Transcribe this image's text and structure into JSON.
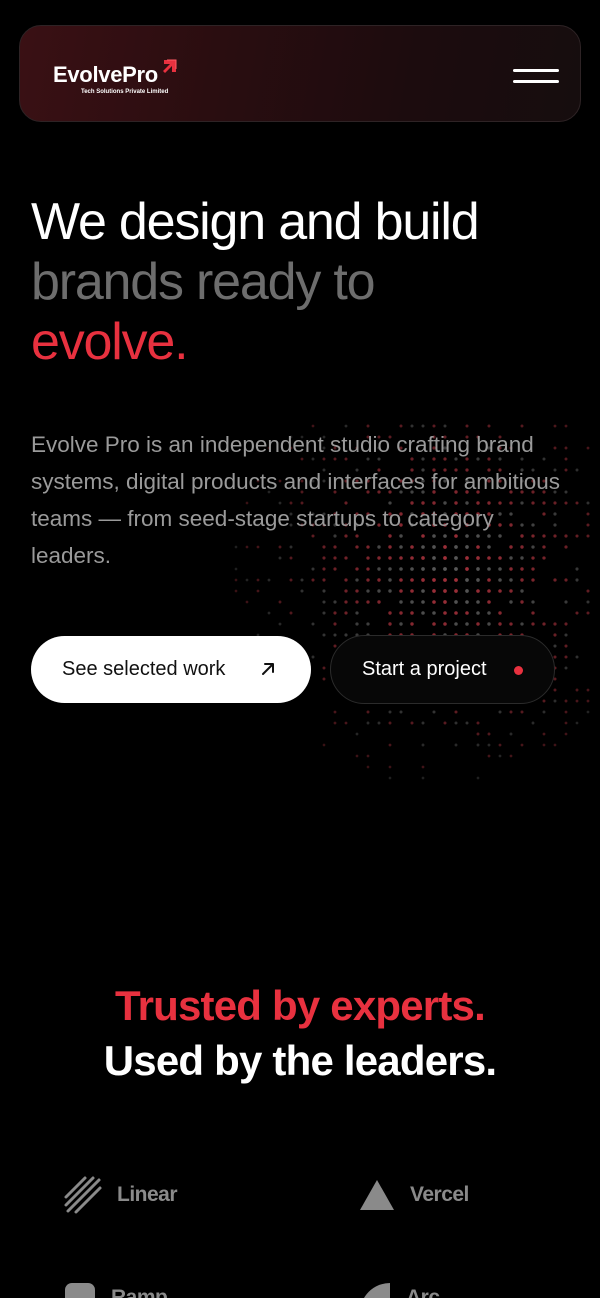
{
  "header": {
    "logo_text": "EvolvePro",
    "logo_subtitle": "Tech Solutions Private Limited",
    "menu_icon": "hamburger-menu-icon"
  },
  "hero": {
    "title_line1": "We design and build",
    "title_line2": "brands ready to",
    "title_line3": "evolve.",
    "description": "Evolve Pro is an independent studio crafting brand systems, digital products and interfaces for ambitious teams — from seed-stage startups to category leaders.",
    "primary_button": "See selected work",
    "secondary_button": "Start a project"
  },
  "trusted": {
    "line1": "Trusted by experts.",
    "line2": "Used by the leaders."
  },
  "brands": [
    {
      "name": "Linear",
      "icon": "linear-logo-icon"
    },
    {
      "name": "Vercel",
      "icon": "vercel-logo-icon"
    },
    {
      "name": "Ramp",
      "icon": "ramp-logo-icon"
    },
    {
      "name": "Arc",
      "icon": "arc-logo-icon"
    }
  ],
  "colors": {
    "accent": "#e8313f",
    "background": "#000000",
    "muted_text": "#9a9a9a"
  }
}
